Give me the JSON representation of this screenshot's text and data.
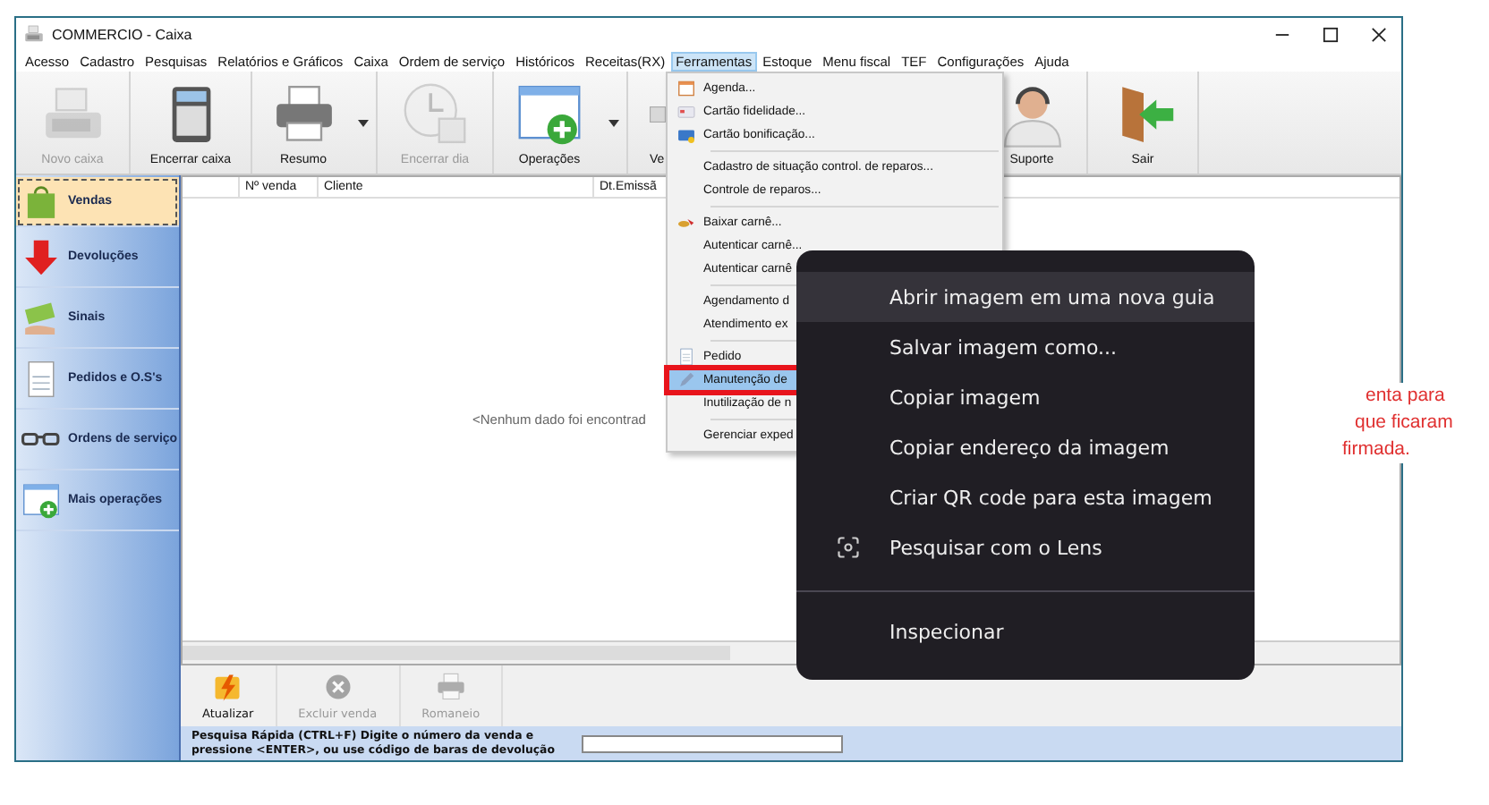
{
  "window": {
    "title": "COMMERCIO - Caixa"
  },
  "menu": [
    {
      "label": "Acesso",
      "selected": false
    },
    {
      "label": "Cadastro",
      "selected": false
    },
    {
      "label": "Pesquisas",
      "selected": false
    },
    {
      "label": "Relatórios e Gráficos",
      "selected": false
    },
    {
      "label": "Caixa",
      "selected": false
    },
    {
      "label": "Ordem de serviço",
      "selected": false
    },
    {
      "label": "Históricos",
      "selected": false
    },
    {
      "label": "Receitas(RX)",
      "selected": false
    },
    {
      "label": "Ferramentas",
      "selected": true
    },
    {
      "label": "Estoque",
      "selected": false
    },
    {
      "label": "Menu fiscal",
      "selected": false
    },
    {
      "label": "TEF",
      "selected": false
    },
    {
      "label": "Configurações",
      "selected": false
    },
    {
      "label": "Ajuda",
      "selected": false
    }
  ],
  "toolbar": {
    "left": [
      {
        "label": "Novo caixa",
        "kind": "register",
        "disabled": true,
        "dropdown": false
      },
      {
        "label": "Encerrar caixa",
        "kind": "calculator",
        "disabled": false,
        "dropdown": false
      },
      {
        "label": "Resumo",
        "kind": "printer",
        "disabled": false,
        "dropdown": true
      },
      {
        "label": "Encerrar dia",
        "kind": "clock",
        "disabled": true,
        "dropdown": false
      },
      {
        "label": "Operações",
        "kind": "window-plus",
        "disabled": false,
        "dropdown": true
      },
      {
        "label": "Ve",
        "kind": "note",
        "disabled": false,
        "dropdown": false
      }
    ],
    "right": [
      {
        "label": "Suporte",
        "kind": "support",
        "disabled": false
      },
      {
        "label": "Sair",
        "kind": "exit",
        "disabled": false
      }
    ]
  },
  "sidebar": [
    {
      "label": "Vendas",
      "kind": "bag",
      "selected": true
    },
    {
      "label": "Devoluções",
      "kind": "arrow-down",
      "selected": false
    },
    {
      "label": "Sinais",
      "kind": "money",
      "selected": false
    },
    {
      "label": "Pedidos e O.S's",
      "kind": "document",
      "selected": false
    },
    {
      "label": "Ordens de serviço",
      "kind": "glasses",
      "selected": false
    },
    {
      "label": "Mais operações",
      "kind": "window-plus",
      "selected": false
    }
  ],
  "grid": {
    "columns": [
      "Nº venda",
      "Cliente",
      "Dt.Emissã"
    ],
    "empty_text": "<Nenhum dado foi encontrad",
    "notice_lines": [
      "enta para",
      "que ficaram",
      "firmada."
    ]
  },
  "actions": [
    {
      "label": "Atualizar",
      "kind": "lightning",
      "disabled": false
    },
    {
      "label": "Excluir venda",
      "kind": "x-circle",
      "disabled": true
    },
    {
      "label": "Romaneio",
      "kind": "printer",
      "disabled": true
    }
  ],
  "quick_search": {
    "label": "Pesquisa Rápida (CTRL+F) Digite o número da venda e pressione <ENTER>, ou use código de baras de devolução"
  },
  "tools_menu": [
    {
      "kind": "item",
      "label": "Agenda...",
      "highlighted": false,
      "marked": false
    },
    {
      "kind": "item",
      "label": "Cartão fidelidade...",
      "highlighted": false,
      "marked": false
    },
    {
      "kind": "item",
      "label": "Cartão bonificação...",
      "highlighted": false,
      "marked": false
    },
    {
      "kind": "separator"
    },
    {
      "kind": "item",
      "label": "Cadastro de situação control. de reparos...",
      "highlighted": false,
      "marked": false
    },
    {
      "kind": "item",
      "label": "Controle de reparos...",
      "highlighted": false,
      "marked": false
    },
    {
      "kind": "separator"
    },
    {
      "kind": "item",
      "label": "Baixar carnê...",
      "highlighted": false,
      "marked": false
    },
    {
      "kind": "item",
      "label": "Autenticar carnê...",
      "highlighted": false,
      "marked": false
    },
    {
      "kind": "item",
      "label": "Autenticar carnê",
      "highlighted": false,
      "marked": false
    },
    {
      "kind": "separator"
    },
    {
      "kind": "item",
      "label": "Agendamento d",
      "highlighted": false,
      "marked": false
    },
    {
      "kind": "item",
      "label": "Atendimento ex",
      "highlighted": false,
      "marked": false
    },
    {
      "kind": "separator"
    },
    {
      "kind": "item",
      "label": "Pedido",
      "highlighted": false,
      "marked": false
    },
    {
      "kind": "item",
      "label": "Manutenção de",
      "highlighted": true,
      "marked": true
    },
    {
      "kind": "item",
      "label": "Inutilização de n",
      "highlighted": false,
      "marked": false
    },
    {
      "kind": "separator"
    },
    {
      "kind": "item",
      "label": "Gerenciar exped",
      "highlighted": false,
      "marked": false
    }
  ],
  "context_menu": [
    {
      "kind": "item",
      "label": "Abrir imagem em uma nova guia",
      "highlighted": true
    },
    {
      "kind": "item",
      "label": "Salvar imagem como...",
      "highlighted": false
    },
    {
      "kind": "item",
      "label": "Copiar imagem",
      "highlighted": false
    },
    {
      "kind": "item",
      "label": "Copiar endereço da imagem",
      "highlighted": false
    },
    {
      "kind": "item",
      "label": "Criar QR code para esta imagem",
      "highlighted": false
    },
    {
      "kind": "item",
      "label": "Pesquisar com o Lens",
      "highlighted": false
    },
    {
      "kind": "separator"
    },
    {
      "kind": "item",
      "label": "Inspecionar",
      "highlighted": false
    }
  ]
}
